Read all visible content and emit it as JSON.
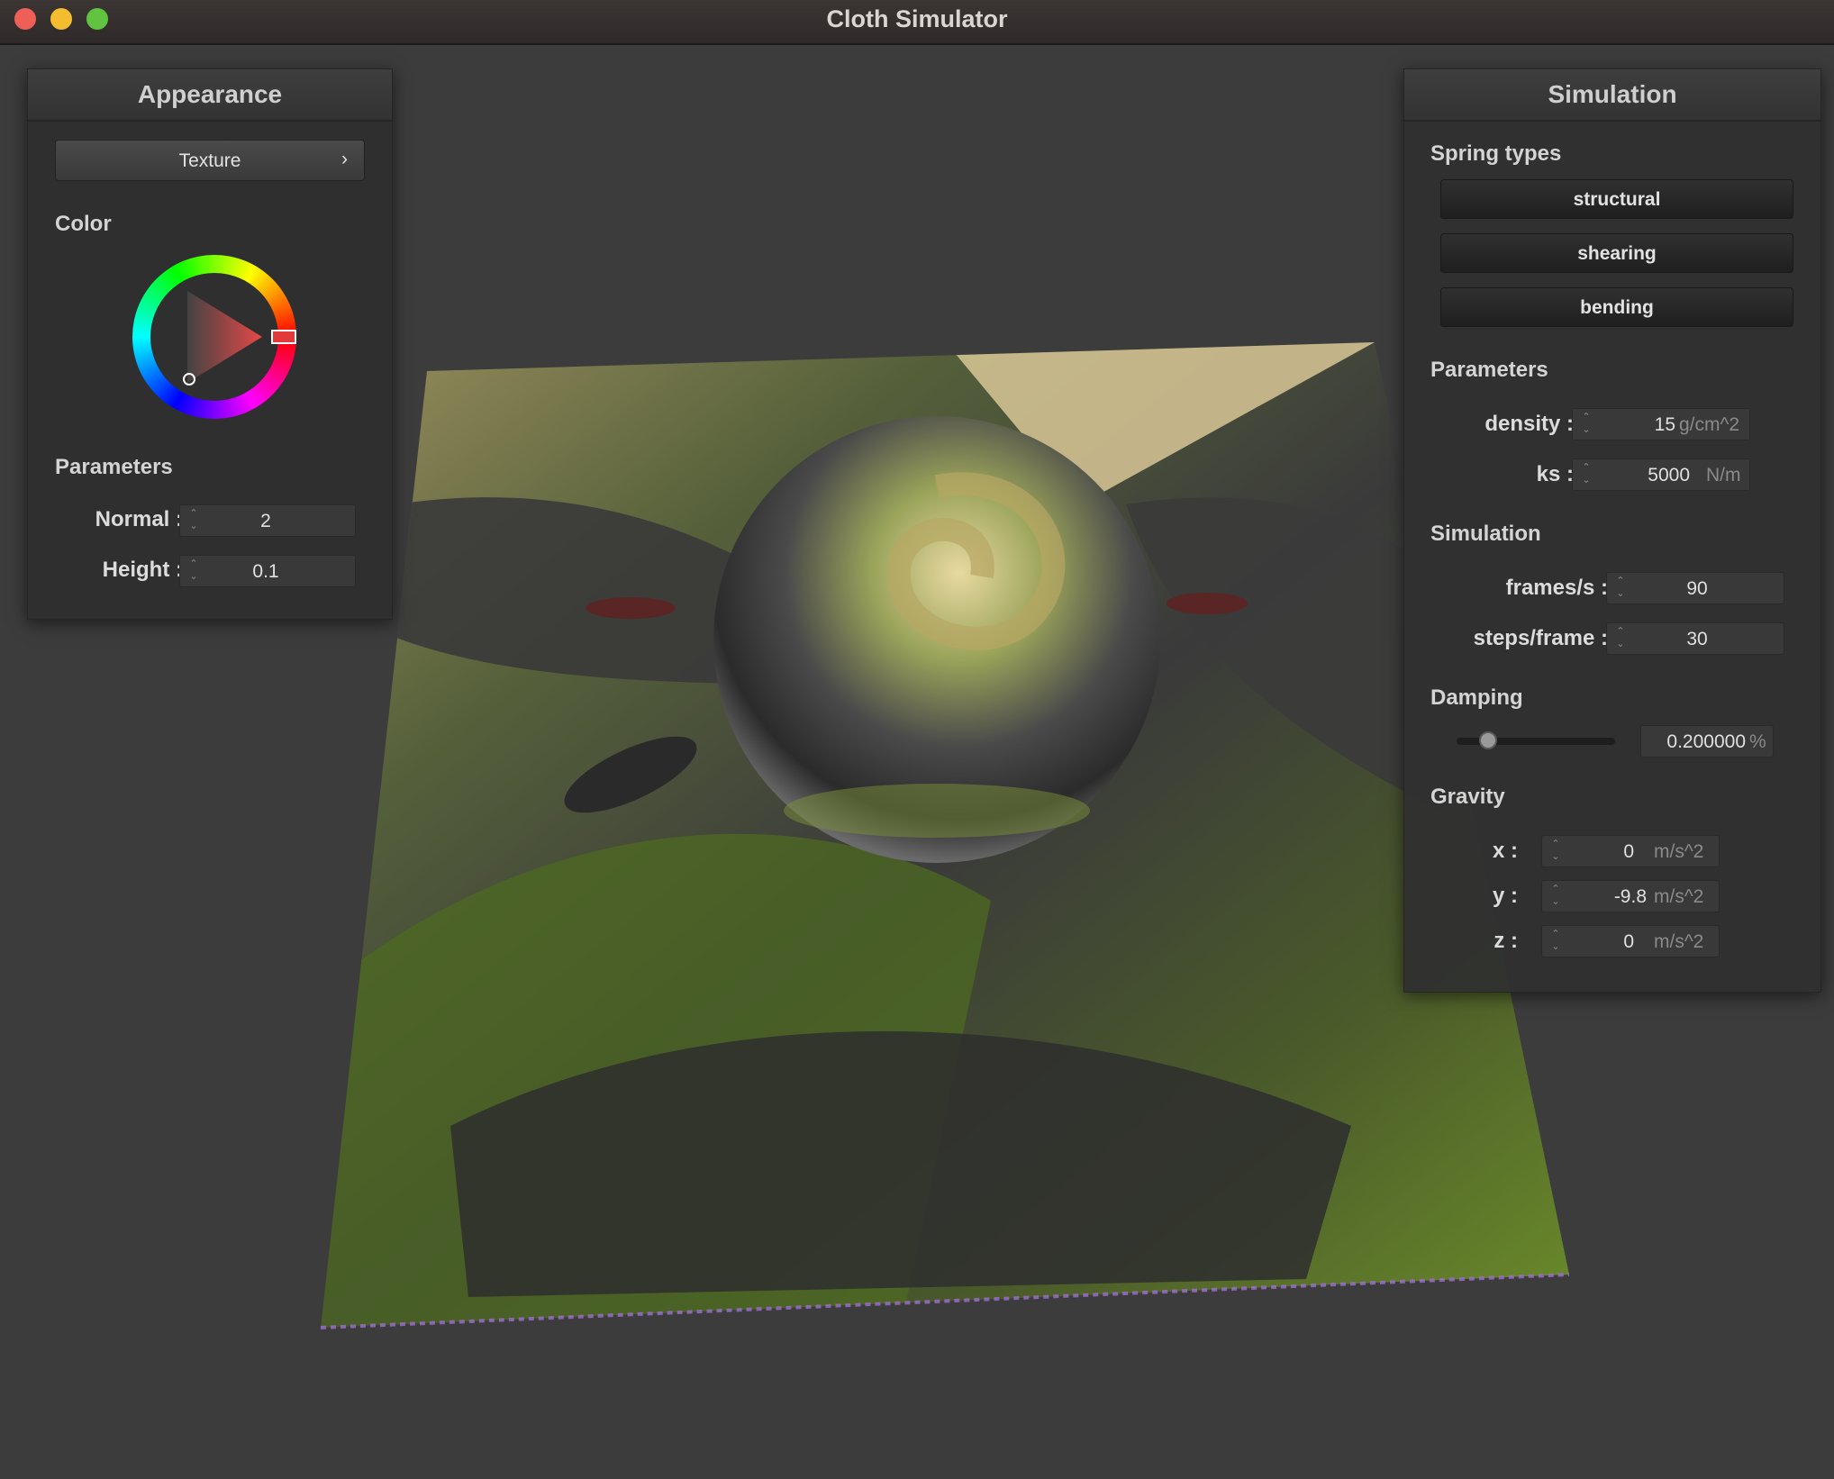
{
  "window": {
    "title": "Cloth Simulator",
    "traffic_lights": {
      "close": "#ee5f57",
      "minimize": "#f4bc2f",
      "zoom": "#60c440"
    }
  },
  "appearance": {
    "header": "Appearance",
    "texture_button": "Texture",
    "texture_chevron": "›",
    "color_label": "Color",
    "selected_color": "#e23a3a",
    "parameters_label": "Parameters",
    "normal": {
      "label": "Normal :",
      "value": "2"
    },
    "height": {
      "label": "Height :",
      "value": "0.1"
    }
  },
  "simulation": {
    "header": "Simulation",
    "spring_types_label": "Spring types",
    "spring_buttons": [
      "structural",
      "shearing",
      "bending"
    ],
    "parameters_label": "Parameters",
    "density": {
      "label": "density :",
      "value": "15",
      "unit": "g/cm^2"
    },
    "ks": {
      "label": "ks :",
      "value": "5000",
      "unit": "N/m"
    },
    "simulation_label": "Simulation",
    "fps": {
      "label": "frames/s :",
      "value": "90"
    },
    "steps": {
      "label": "steps/frame :",
      "value": "30"
    },
    "damping_label": "Damping",
    "damping": {
      "value": "0.200000",
      "unit": "%",
      "slider_fraction": 0.2
    },
    "gravity_label": "Gravity",
    "gravity": [
      {
        "label": "x :",
        "value": "0",
        "unit": "m/s^2"
      },
      {
        "label": "y :",
        "value": "-9.8",
        "unit": "m/s^2"
      },
      {
        "label": "z :",
        "value": "0",
        "unit": "m/s^2"
      }
    ]
  }
}
